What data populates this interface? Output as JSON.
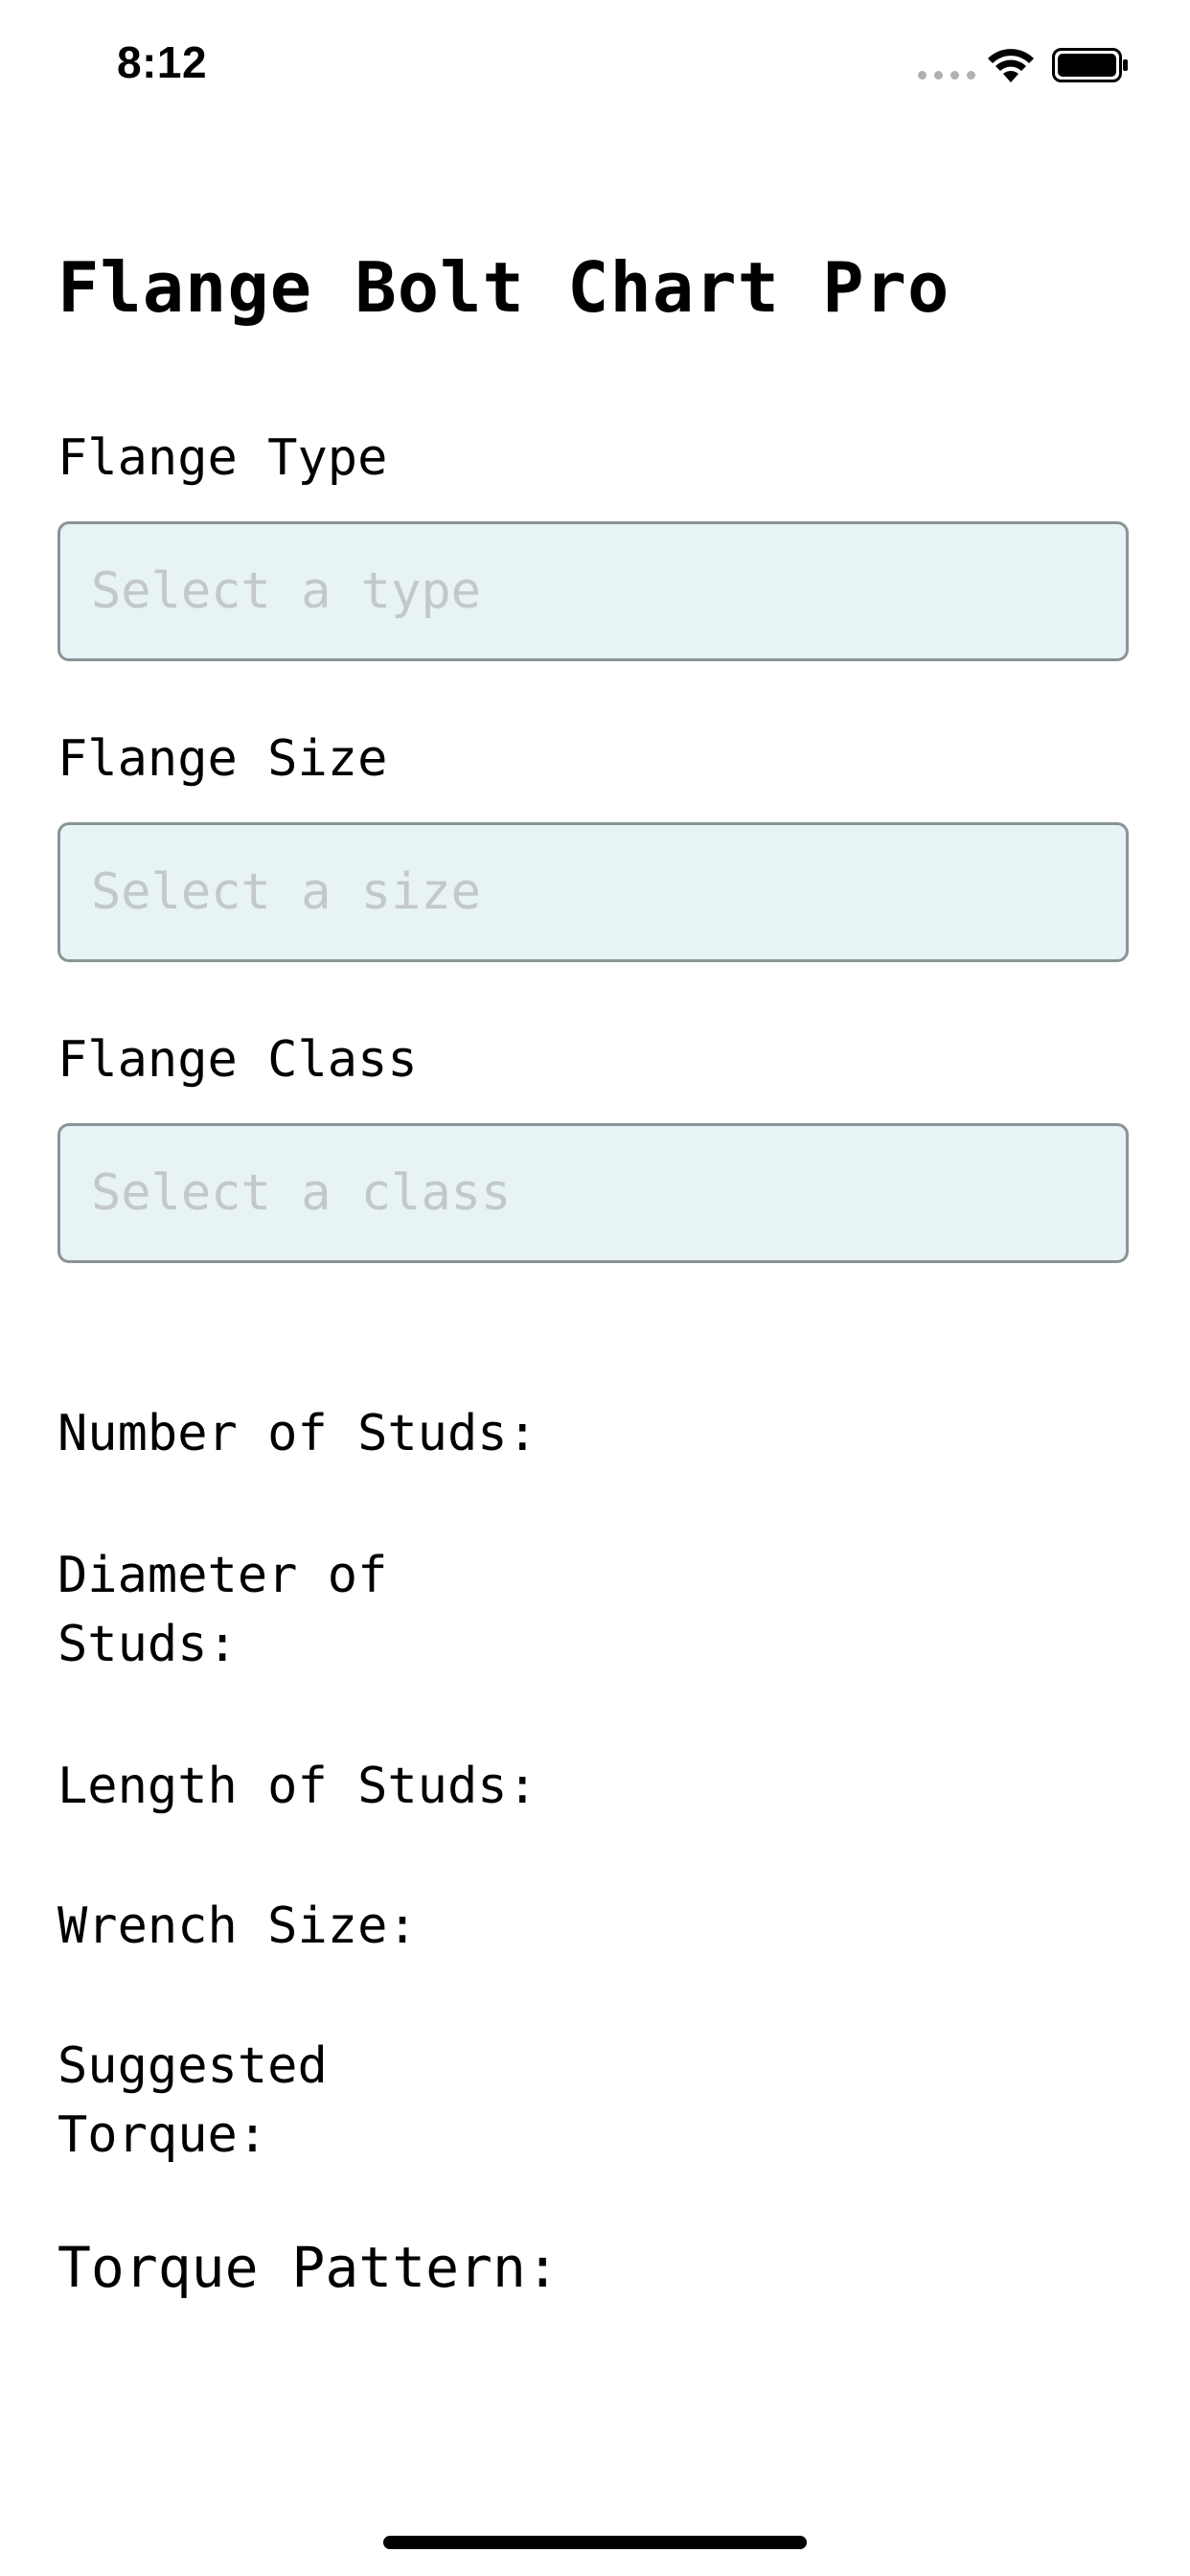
{
  "status_bar": {
    "time": "8:12",
    "icons": [
      "signal-icon",
      "wifi-icon",
      "battery-icon"
    ]
  },
  "app": {
    "title": "Flange Bolt Chart Pro"
  },
  "fields": {
    "type": {
      "label": "Flange Type",
      "placeholder": "Select a type",
      "value": ""
    },
    "size": {
      "label": "Flange Size",
      "placeholder": "Select a size",
      "value": ""
    },
    "class": {
      "label": "Flange Class",
      "placeholder": "Select a class",
      "value": ""
    }
  },
  "results": {
    "number_of_studs": "Number of Studs:",
    "diameter_of_studs": "Diameter of Studs:",
    "length_of_studs": "Length of Studs:",
    "wrench_size": "Wrench Size:",
    "suggested_torque": "Suggested Torque:",
    "torque_pattern": "Torque Pattern:"
  },
  "colors": {
    "field_background": "#e7f3f5",
    "field_border": "#8a9496",
    "placeholder": "#c3c8c9"
  }
}
